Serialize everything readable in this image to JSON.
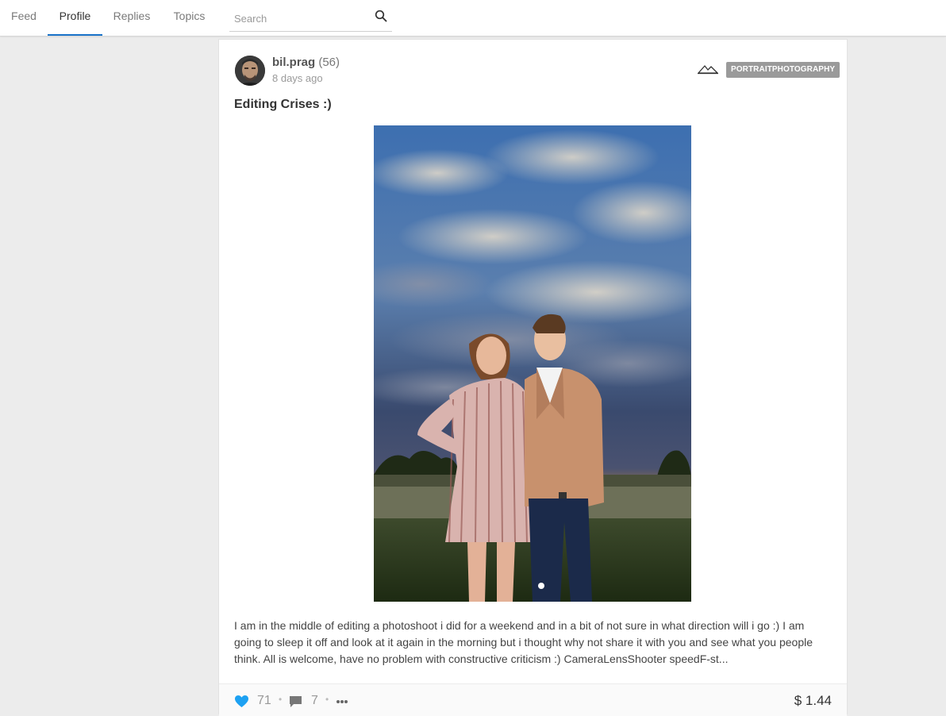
{
  "nav": {
    "tabs": [
      {
        "label": "Feed"
      },
      {
        "label": "Profile",
        "active": true
      },
      {
        "label": "Replies"
      },
      {
        "label": "Topics"
      }
    ],
    "search": {
      "placeholder": "Search",
      "value": ""
    }
  },
  "post": {
    "author": {
      "name": "bil.prag",
      "reputation": "(56)"
    },
    "timestamp": "8 days ago",
    "tag": "PORTRAITPHOTOGRAPHY",
    "title": "Editing Crises :)",
    "body": "I am in the middle of editing a photoshoot i did for a weekend and in a bit of not sure in what direction will i go :) I am going to sleep it off and look at it again in the morning but i thought why not share it with you and see what you people think. All is welcome, have no problem with constructive criticism :) CameraLensShooter speedF-st...",
    "votes": "71",
    "comments": "7",
    "payout": "$ 1.44"
  },
  "colors": {
    "accent": "#1a73c9",
    "heart": "#1da1f2",
    "tag_bg": "#9a9a9a"
  },
  "icons": [
    "search-icon",
    "community-mountain-icon",
    "heart-icon",
    "comment-icon",
    "more-icon"
  ]
}
